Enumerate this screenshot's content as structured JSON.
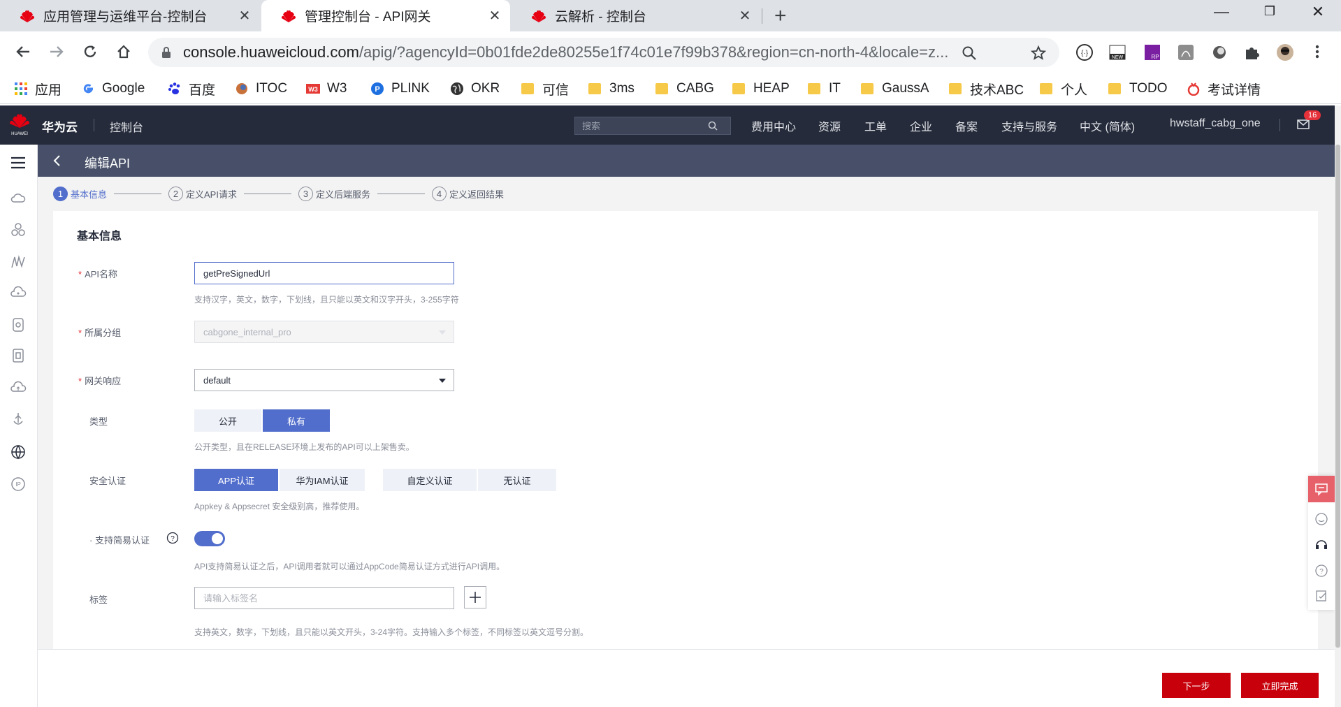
{
  "browser": {
    "tabs": [
      {
        "title": "应用管理与运维平台-控制台"
      },
      {
        "title": "管理控制台 - API网关"
      },
      {
        "title": "云解析 - 控制台"
      }
    ],
    "url_host": "console.huaweicloud.com",
    "url_path": "/apig/?agencyId=0b01fde2de80255e1f74c01e7f99b378&region=cn-north-4&locale=z...",
    "bookmarks": [
      "应用",
      "Google",
      "百度",
      "ITOC",
      "W3",
      "PLINK",
      "OKR",
      "可信",
      "3ms",
      "CABG",
      "HEAP",
      "IT",
      "GaussA",
      "技术ABC",
      "个人",
      "TODO",
      "考试详情"
    ]
  },
  "header": {
    "brand": "华为云",
    "console": "控制台",
    "search_placeholder": "搜索",
    "nav": [
      "费用中心",
      "资源",
      "工单",
      "企业",
      "备案",
      "支持与服务",
      "中文 (简体)",
      "hwstaff_cabg_one"
    ],
    "badge_count": "16"
  },
  "page": {
    "title": "编辑API",
    "steps": [
      {
        "num": "1",
        "label": "基本信息"
      },
      {
        "num": "2",
        "label": "定义API请求"
      },
      {
        "num": "3",
        "label": "定义后端服务"
      },
      {
        "num": "4",
        "label": "定义返回结果"
      }
    ]
  },
  "form": {
    "section_title": "基本信息",
    "api_name": {
      "label": "API名称",
      "value": "getPreSignedUrl",
      "hint": "支持汉字，英文，数字，下划线，且只能以英文和汉字开头，3-255字符"
    },
    "group": {
      "label": "所属分组",
      "value": "cabgone_internal_pro"
    },
    "gateway_response": {
      "label": "网关响应",
      "value": "default"
    },
    "type": {
      "label": "类型",
      "options": [
        "公开",
        "私有"
      ],
      "selected": "私有",
      "hint": "公开类型，且在RELEASE环境上发布的API可以上架售卖。"
    },
    "auth": {
      "label": "安全认证",
      "options": [
        "APP认证",
        "华为IAM认证",
        "自定义认证",
        "无认证"
      ],
      "selected": "APP认证",
      "hint": "Appkey & Appsecret 安全级别高，推荐使用。"
    },
    "simple_auth": {
      "label": "支持简易认证",
      "enabled": true,
      "hint": "API支持简易认证之后，API调用者就可以通过AppCode简易认证方式进行API调用。"
    },
    "tags": {
      "label": "标签",
      "placeholder": "请输入标签名",
      "hint": "支持英文，数字，下划线，且只能以英文开头，3-24字符。支持输入多个标签，不同标签以英文逗号分割。"
    }
  },
  "footer": {
    "next": "下一步",
    "finish": "立即完成"
  },
  "colors": {
    "primary": "#526ecc",
    "danger": "#c7000b",
    "header_bg": "#252b3a",
    "pagebar_bg": "#475068"
  }
}
